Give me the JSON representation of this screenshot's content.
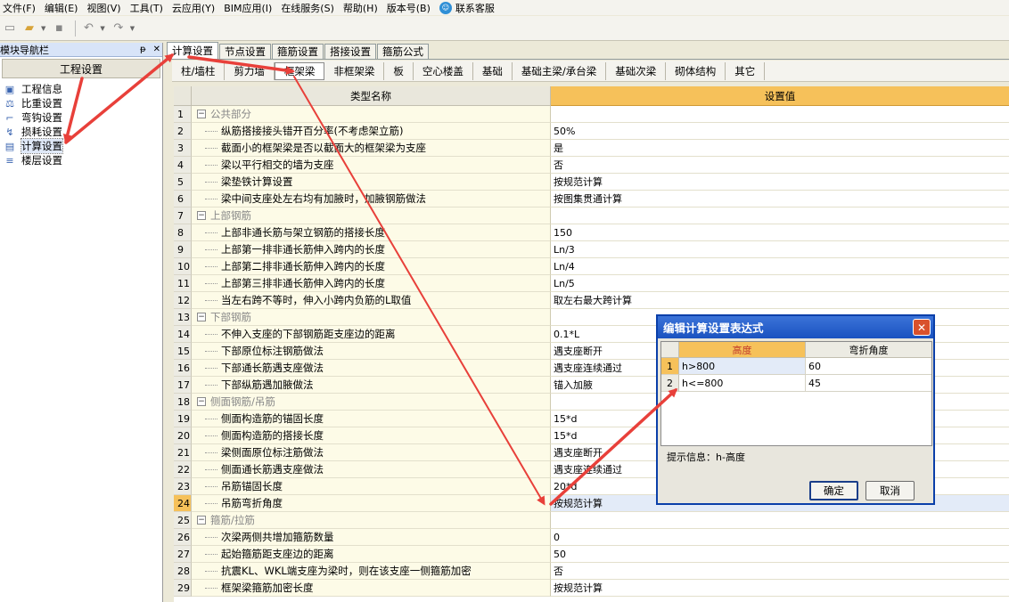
{
  "menu": [
    "文件(F)",
    "编辑(E)",
    "视图(V)",
    "工具(T)",
    "云应用(Y)",
    "BIM应用(I)",
    "在线服务(S)",
    "帮助(H)",
    "版本号(B)"
  ],
  "menu_service": "联系客服",
  "nav": {
    "title": "模块导航栏",
    "pin": "ᵽ",
    "close": "✕",
    "header": "工程设置",
    "items": [
      {
        "label": "工程信息",
        "icon": "info-icon"
      },
      {
        "label": "比重设置",
        "icon": "weight-icon"
      },
      {
        "label": "弯钩设置",
        "icon": "hook-icon"
      },
      {
        "label": "损耗设置",
        "icon": "loss-icon"
      },
      {
        "label": "计算设置",
        "icon": "calc-icon"
      },
      {
        "label": "楼层设置",
        "icon": "floor-icon"
      }
    ]
  },
  "tabs1": [
    "计算设置",
    "节点设置",
    "箍筋设置",
    "搭接设置",
    "箍筋公式"
  ],
  "tabs2": [
    "柱/墙柱",
    "剪力墙",
    "框架梁",
    "非框架梁",
    "板",
    "空心楼盖",
    "基础",
    "基础主梁/承台梁",
    "基础次梁",
    "砌体结构",
    "其它"
  ],
  "grid": {
    "col_name": "类型名称",
    "col_value": "设置值",
    "rows": [
      {
        "n": "1",
        "name": "公共部分",
        "value": "",
        "group": true
      },
      {
        "n": "2",
        "name": "纵筋搭接接头错开百分率(不考虑架立筋)",
        "value": "50%"
      },
      {
        "n": "3",
        "name": "截面小的框架梁是否以截面大的框架梁为支座",
        "value": "是"
      },
      {
        "n": "4",
        "name": "梁以平行相交的墙为支座",
        "value": "否"
      },
      {
        "n": "5",
        "name": "梁垫铁计算设置",
        "value": "按规范计算"
      },
      {
        "n": "6",
        "name": "梁中间支座处左右均有加腋时，加腋钢筋做法",
        "value": "按图集贯通计算"
      },
      {
        "n": "7",
        "name": "上部钢筋",
        "value": "",
        "group": true
      },
      {
        "n": "8",
        "name": "上部非通长筋与架立钢筋的搭接长度",
        "value": "150"
      },
      {
        "n": "9",
        "name": "上部第一排非通长筋伸入跨内的长度",
        "value": "Ln/3"
      },
      {
        "n": "10",
        "name": "上部第二排非通长筋伸入跨内的长度",
        "value": "Ln/4"
      },
      {
        "n": "11",
        "name": "上部第三排非通长筋伸入跨内的长度",
        "value": "Ln/5"
      },
      {
        "n": "12",
        "name": "当左右跨不等时，伸入小跨内负筋的L取值",
        "value": "取左右最大跨计算"
      },
      {
        "n": "13",
        "name": "下部钢筋",
        "value": "",
        "group": true
      },
      {
        "n": "14",
        "name": "不伸入支座的下部钢筋距支座边的距离",
        "value": "0.1*L"
      },
      {
        "n": "15",
        "name": "下部原位标注钢筋做法",
        "value": "遇支座断开"
      },
      {
        "n": "16",
        "name": "下部通长筋遇支座做法",
        "value": "遇支座连续通过"
      },
      {
        "n": "17",
        "name": "下部纵筋遇加腋做法",
        "value": "锚入加腋"
      },
      {
        "n": "18",
        "name": "侧面钢筋/吊筋",
        "value": "",
        "group": true
      },
      {
        "n": "19",
        "name": "侧面构造筋的锚固长度",
        "value": "15*d"
      },
      {
        "n": "20",
        "name": "侧面构造筋的搭接长度",
        "value": "15*d"
      },
      {
        "n": "21",
        "name": "梁侧面原位标注筋做法",
        "value": "遇支座断开"
      },
      {
        "n": "22",
        "name": "侧面通长筋遇支座做法",
        "value": "遇支座连续通过"
      },
      {
        "n": "23",
        "name": "吊筋锚固长度",
        "value": "20*d"
      },
      {
        "n": "24",
        "name": "吊筋弯折角度",
        "value": "按规范计算",
        "selected": true
      },
      {
        "n": "25",
        "name": "箍筋/拉筋",
        "value": "",
        "group": true
      },
      {
        "n": "26",
        "name": "次梁两侧共增加箍筋数量",
        "value": "0"
      },
      {
        "n": "27",
        "name": "起始箍筋距支座边的距离",
        "value": "50"
      },
      {
        "n": "28",
        "name": "抗震KL、WKL端支座为梁时，则在该支座一侧箍筋加密",
        "value": "否"
      },
      {
        "n": "29",
        "name": "框架梁箍筋加密长度",
        "value": "按规范计算"
      }
    ]
  },
  "dialog": {
    "title": "编辑计算设置表达式",
    "close": "✕",
    "col1": "高度",
    "col2": "弯折角度",
    "rows": [
      {
        "n": "1",
        "c1": "h>800",
        "c2": "60"
      },
      {
        "n": "2",
        "c1": "h<=800",
        "c2": "45"
      }
    ],
    "hint": "提示信息：h-高度",
    "ok": "确定",
    "cancel": "取消"
  },
  "colors": {
    "accent": "#f6c15a",
    "arrow": "#e8403a",
    "title_bar": "#1a52c0"
  }
}
